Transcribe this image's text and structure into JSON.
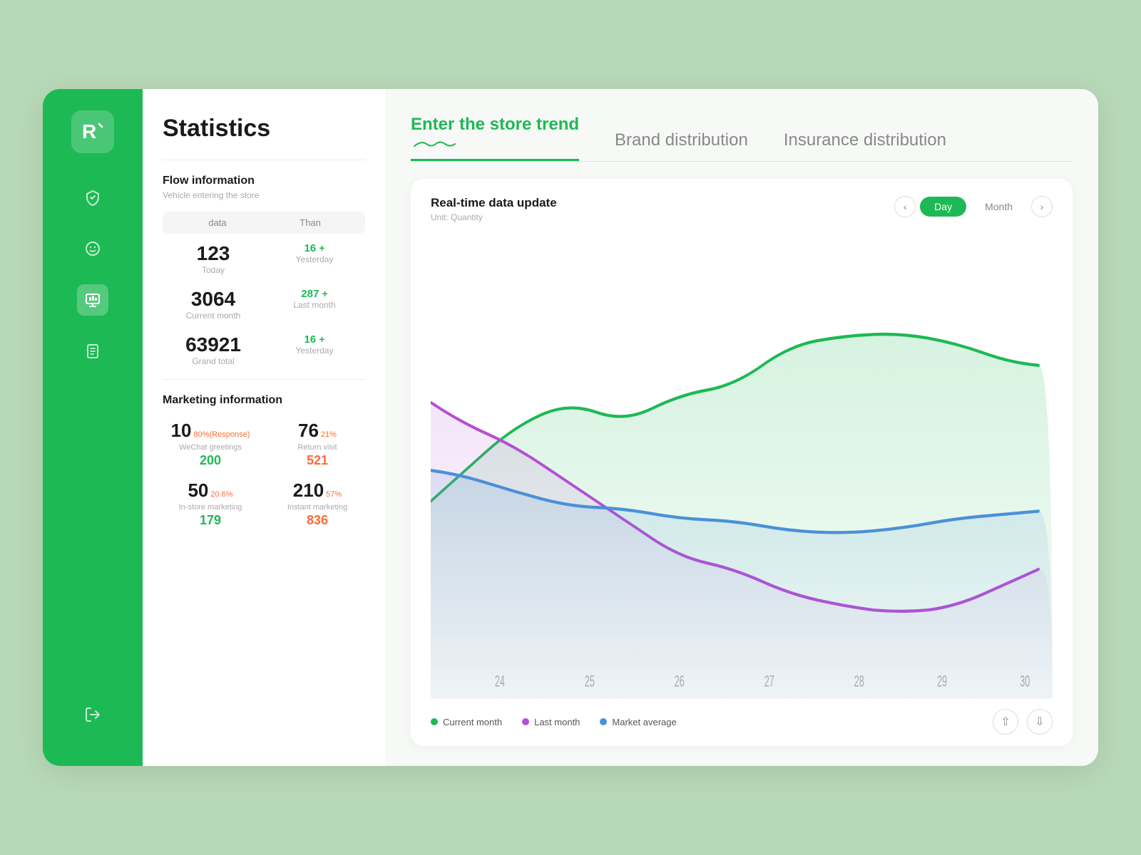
{
  "sidebar": {
    "logo_text": "R",
    "nav_items": [
      {
        "name": "shield-icon",
        "icon": "✓",
        "active": false
      },
      {
        "name": "face-icon",
        "icon": "☺",
        "active": false
      },
      {
        "name": "monitor-icon",
        "icon": "▦",
        "active": true
      },
      {
        "name": "document-icon",
        "icon": "☰",
        "active": false
      }
    ],
    "logout_icon": "→"
  },
  "stats": {
    "title": "Statistics",
    "flow_section": {
      "title": "Flow information",
      "subtitle": "Vehicle entering the store",
      "col1": "data",
      "col2": "Than",
      "rows": [
        {
          "value": "123",
          "label": "Today",
          "diff": "16 +",
          "diff_label": "Yesterday"
        },
        {
          "value": "3064",
          "label": "Current month",
          "diff": "287 +",
          "diff_label": "Last month"
        },
        {
          "value": "63921",
          "label": "Grand total",
          "diff": "16 +",
          "diff_label": "Yesterday"
        }
      ]
    },
    "marketing_section": {
      "title": "Marketing information",
      "items": [
        {
          "main": "10",
          "pct": "80%(Response)",
          "label": "WeChat greetings",
          "sub": "200",
          "sub_color": "green"
        },
        {
          "main": "76",
          "pct": "21%",
          "label": "Return visit",
          "sub": "521",
          "sub_color": "orange"
        },
        {
          "main": "50",
          "pct": "20.6%",
          "label": "In-store marketing",
          "sub": "179",
          "sub_color": "green"
        },
        {
          "main": "210",
          "pct": "57%",
          "label": "Instant marketing",
          "sub": "836",
          "sub_color": "orange"
        }
      ]
    }
  },
  "main": {
    "tabs": [
      {
        "label": "Enter the store trend",
        "active": true
      },
      {
        "label": "Brand distribution",
        "active": false
      },
      {
        "label": "Insurance distribution",
        "active": false
      }
    ],
    "chart": {
      "title": "Real-time data update",
      "unit": "Unit: Quantity",
      "day_btn": "Day",
      "month_btn": "Month",
      "x_labels": [
        "24",
        "25",
        "26",
        "27",
        "28",
        "29",
        "30"
      ],
      "legend": [
        {
          "label": "Current month",
          "color": "#1db954"
        },
        {
          "label": "Last month",
          "color": "#b44fd4"
        },
        {
          "label": "Market average",
          "color": "#4a90d9"
        }
      ]
    }
  }
}
